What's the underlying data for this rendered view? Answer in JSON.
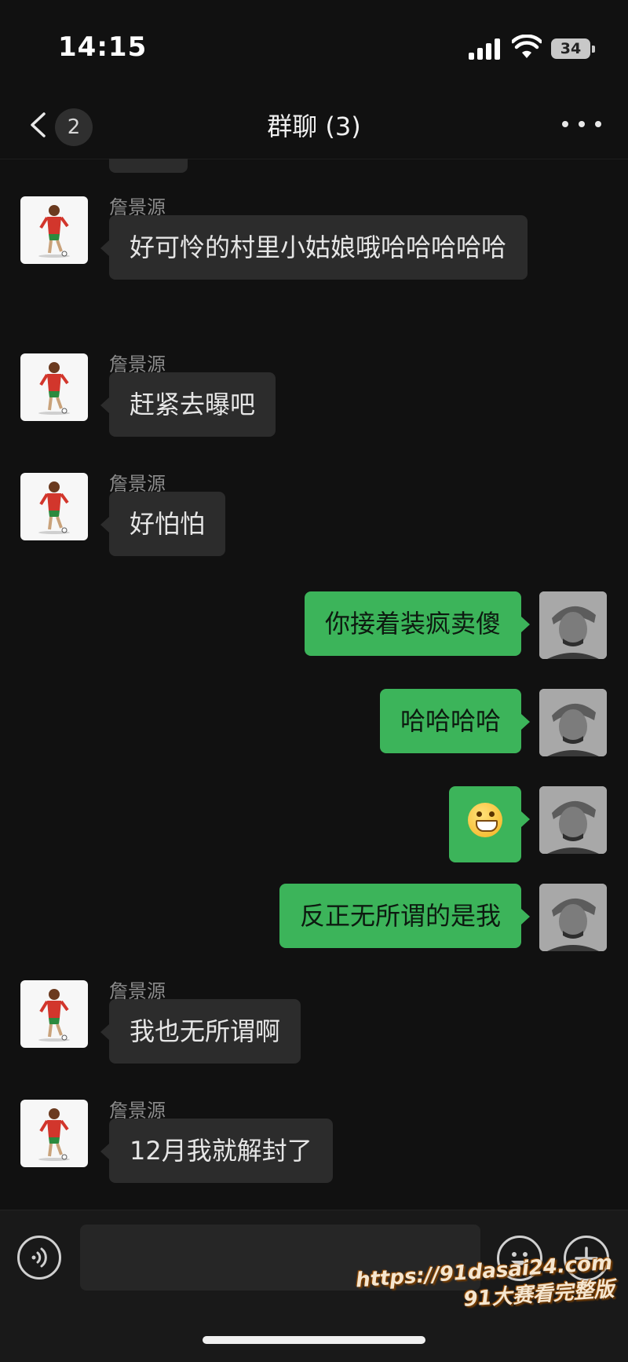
{
  "status_bar": {
    "time": "14:15",
    "battery": "34"
  },
  "header": {
    "title": "群聊 (3)",
    "unread_count": "2"
  },
  "messages": [
    {
      "side": "in",
      "sender": "詹景源",
      "text": "好可怜的村里小姑娘哦哈哈哈哈哈"
    },
    {
      "side": "in",
      "sender": "詹景源",
      "text": "赶紧去曝吧"
    },
    {
      "side": "in",
      "sender": "詹景源",
      "text": "好怕怕"
    },
    {
      "side": "out",
      "text": "你接着装疯卖傻"
    },
    {
      "side": "out",
      "text": "哈哈哈哈"
    },
    {
      "side": "out",
      "emoji": "grinning-face"
    },
    {
      "side": "out",
      "text": "反正无所谓的是我"
    },
    {
      "side": "in",
      "sender": "詹景源",
      "text": "我也无所谓啊"
    },
    {
      "side": "in",
      "sender": "詹景源",
      "text": "12月我就解封了"
    }
  ],
  "input": {
    "value": ""
  },
  "watermark": {
    "line1": "https://91dasai24.com",
    "line2": "91大赛看完整版"
  },
  "colors": {
    "background": "#111111",
    "incoming_bubble": "#2c2c2c",
    "outgoing_bubble": "#3cb45a"
  }
}
